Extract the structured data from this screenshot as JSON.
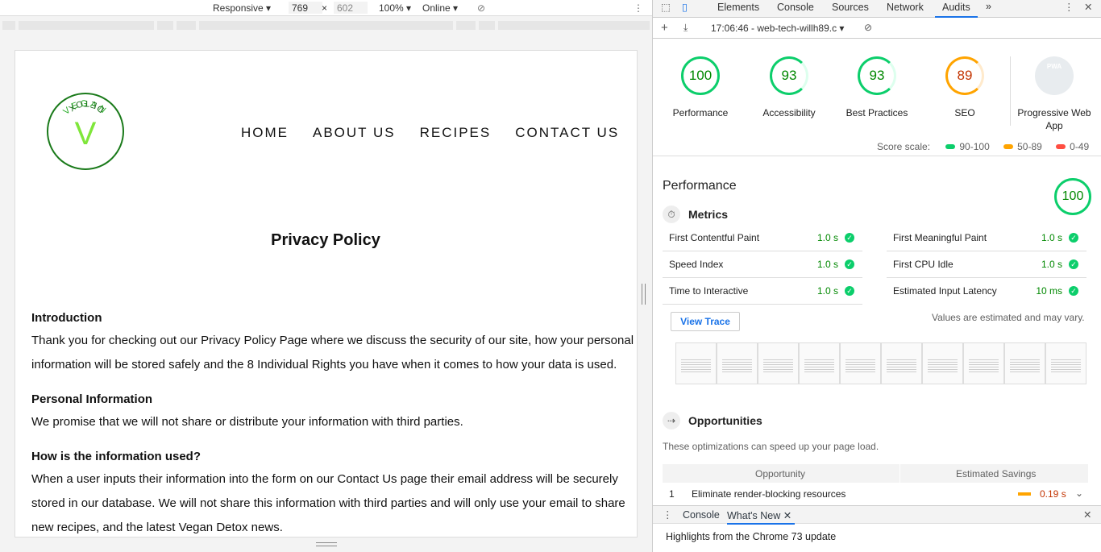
{
  "device_toolbar": {
    "mode": "Responsive",
    "width": "769",
    "height": "602",
    "zoom": "100%",
    "network": "Online"
  },
  "site": {
    "logo_text_top": "VEGAN",
    "logo_letter": "V",
    "logo_text_bottom": "DETOX",
    "nav": [
      "HOME",
      "ABOUT US",
      "RECIPES",
      "CONTACT US"
    ],
    "title": "Privacy Policy",
    "sections": [
      {
        "heading": "Introduction",
        "body": "Thank you for checking out our Privacy Policy Page where we discuss the security of our site, how your personal information will be stored safely and the 8 Individual Rights you have when it comes to how your data is used."
      },
      {
        "heading": "Personal Information",
        "body": "We promise that we will not share or distribute your information with third parties."
      },
      {
        "heading": "How is the information used?",
        "body": "When a user inputs their information into the form on our Contact Us page their email address will be securely stored in our database. We will not share this information with third parties and will only use your email to share new recipes, and the latest Vegan Detox news."
      }
    ]
  },
  "devtools": {
    "tabs": [
      "Elements",
      "Console",
      "Sources",
      "Network",
      "Audits"
    ],
    "active_tab": "Audits",
    "audit_run": "17:06:46 - web-tech-willh89.c",
    "gauges": [
      {
        "score": "100",
        "label": "Performance",
        "color": "#0cce6b",
        "text": "#008800"
      },
      {
        "score": "93",
        "label": "Accessibility",
        "color": "#0cce6b",
        "text": "#008800"
      },
      {
        "score": "93",
        "label": "Best Practices",
        "color": "#0cce6b",
        "text": "#008800"
      },
      {
        "score": "89",
        "label": "SEO",
        "color": "#ffa400",
        "text": "#c33300"
      }
    ],
    "pwa": {
      "badge": "PWA",
      "label": "Progressive Web App"
    },
    "scale": {
      "title": "Score scale:",
      "green": "90-100",
      "orange": "50-89",
      "red": "0-49"
    },
    "performance": {
      "title": "Performance",
      "score": "100",
      "metrics_title": "Metrics",
      "metrics": [
        {
          "name": "First Contentful Paint",
          "value": "1.0 s"
        },
        {
          "name": "First Meaningful Paint",
          "value": "1.0 s"
        },
        {
          "name": "Speed Index",
          "value": "1.0 s"
        },
        {
          "name": "First CPU Idle",
          "value": "1.0 s"
        },
        {
          "name": "Time to Interactive",
          "value": "1.0 s"
        },
        {
          "name": "Estimated Input Latency",
          "value": "10 ms"
        }
      ],
      "view_trace": "View Trace",
      "estimate_note": "Values are estimated and may vary.",
      "opportunities_title": "Opportunities",
      "opportunities_desc": "These optimizations can speed up your page load.",
      "opp_col1": "Opportunity",
      "opp_col2": "Estimated Savings",
      "opp_rows": [
        {
          "n": "1",
          "name": "Eliminate render-blocking resources",
          "savings": "0.19 s"
        }
      ]
    },
    "drawer": {
      "tabs": [
        "Console",
        "What's New"
      ],
      "body": "Highlights from the Chrome 73 update"
    }
  }
}
